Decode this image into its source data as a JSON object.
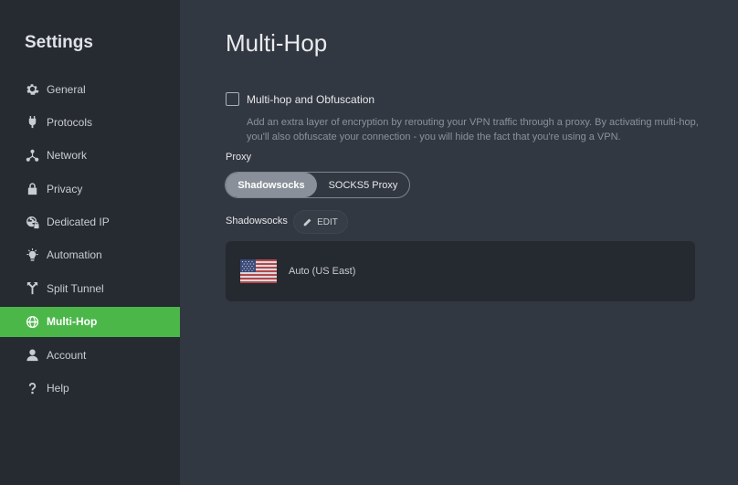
{
  "sidebar": {
    "title": "Settings",
    "items": [
      {
        "label": "General",
        "icon": "gear-icon"
      },
      {
        "label": "Protocols",
        "icon": "plug-icon"
      },
      {
        "label": "Network",
        "icon": "network-icon"
      },
      {
        "label": "Privacy",
        "icon": "lock-icon"
      },
      {
        "label": "Dedicated IP",
        "icon": "globe-lock-icon"
      },
      {
        "label": "Automation",
        "icon": "lightbulb-icon"
      },
      {
        "label": "Split Tunnel",
        "icon": "split-icon"
      },
      {
        "label": "Multi-Hop",
        "icon": "multihop-globe-icon"
      },
      {
        "label": "Account",
        "icon": "user-icon"
      },
      {
        "label": "Help",
        "icon": "question-icon"
      }
    ],
    "active_index": 7
  },
  "main": {
    "title": "Multi-Hop",
    "option": {
      "label": "Multi-hop and Obfuscation",
      "checked": false,
      "description": "Add an extra layer of encryption by rerouting your VPN traffic through a proxy. By activating multi-hop, you'll also obfuscate your connection - you will hide the fact that you're using a VPN."
    },
    "proxy": {
      "label": "Proxy",
      "options": [
        "Shadowsocks",
        "SOCKS5 Proxy"
      ],
      "selected": "Shadowsocks"
    },
    "shadowsocks": {
      "label": "Shadowsocks",
      "edit_label": "EDIT"
    },
    "server": {
      "name": "Auto (US East)",
      "flag_icon": "us-flag-icon"
    }
  },
  "colors": {
    "sidebar_bg": "#262a31",
    "main_bg": "#323841",
    "accent_green": "#4bb749",
    "card_bg": "#252930"
  }
}
